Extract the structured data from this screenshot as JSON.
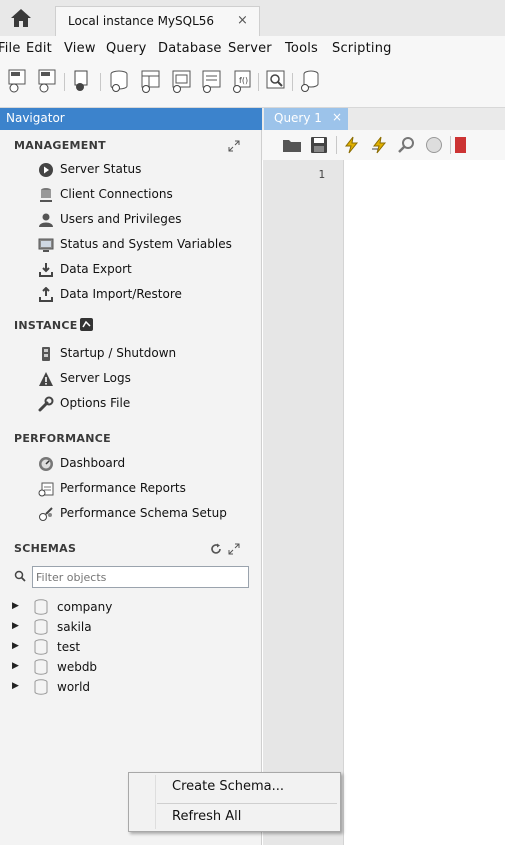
{
  "window": {
    "connection_tab_label": "Local instance MySQL56",
    "connection_tab_close": "×"
  },
  "menu": [
    "File",
    "Edit",
    "View",
    "Query",
    "Database",
    "Server",
    "Tools",
    "Scripting"
  ],
  "navigator": {
    "header": "Navigator",
    "management": {
      "title": "MANAGEMENT",
      "items": [
        {
          "label": "Server Status",
          "icon": "server-status-icon"
        },
        {
          "label": "Client Connections",
          "icon": "client-connections-icon"
        },
        {
          "label": "Users and Privileges",
          "icon": "users-icon"
        },
        {
          "label": "Status and System Variables",
          "icon": "system-variables-icon"
        },
        {
          "label": "Data Export",
          "icon": "data-export-icon"
        },
        {
          "label": "Data Import/Restore",
          "icon": "data-import-icon"
        }
      ]
    },
    "instance": {
      "title": "INSTANCE",
      "items": [
        {
          "label": "Startup / Shutdown",
          "icon": "startup-icon"
        },
        {
          "label": "Server Logs",
          "icon": "warning-icon"
        },
        {
          "label": "Options File",
          "icon": "wrench-icon"
        }
      ]
    },
    "performance": {
      "title": "PERFORMANCE",
      "items": [
        {
          "label": "Dashboard",
          "icon": "dashboard-icon"
        },
        {
          "label": "Performance Reports",
          "icon": "reports-icon"
        },
        {
          "label": "Performance Schema Setup",
          "icon": "schema-setup-icon"
        }
      ]
    },
    "schemas": {
      "title": "SCHEMAS",
      "filter_placeholder": "Filter objects",
      "items": [
        "company",
        "sakila",
        "test",
        "webdb",
        "world"
      ]
    }
  },
  "editor": {
    "tab_label": "Query 1",
    "tab_close": "×",
    "line_number": "1"
  },
  "context_menu": {
    "items": [
      "Create Schema...",
      "Refresh All"
    ]
  }
}
